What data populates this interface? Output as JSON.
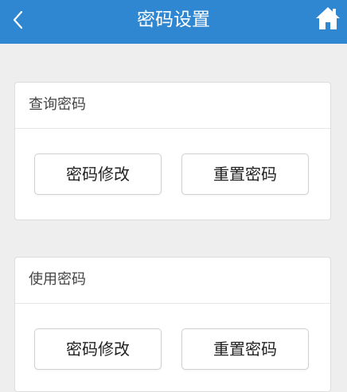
{
  "header": {
    "title": "密码设置",
    "back_icon": "chevron-left-icon",
    "home_icon": "home-icon",
    "background_color": "#2f87d2"
  },
  "sections": [
    {
      "title": "查询密码",
      "buttons": [
        {
          "label": "密码修改"
        },
        {
          "label": "重置密码"
        }
      ]
    },
    {
      "title": "使用密码",
      "buttons": [
        {
          "label": "密码修改"
        },
        {
          "label": "重置密码"
        }
      ]
    }
  ]
}
